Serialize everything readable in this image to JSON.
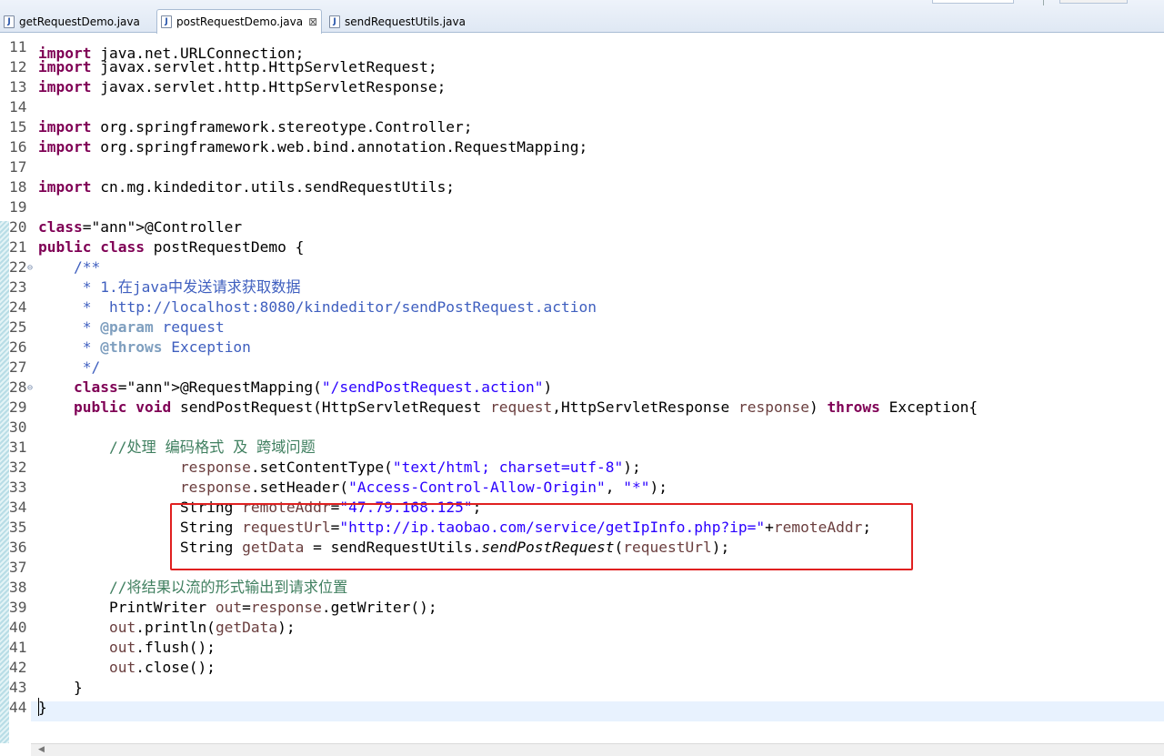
{
  "tabs": [
    {
      "label": "getRequestDemo.java",
      "active": false,
      "icon": "java-file-icon"
    },
    {
      "label": "postRequestDemo.java",
      "active": true,
      "icon": "java-file-icon",
      "close": "⊠"
    },
    {
      "label": "sendRequestUtils.java",
      "active": false,
      "icon": "java-file-icon"
    }
  ],
  "code": {
    "partial_line": "import java.net.URLConnection;",
    "lines": [
      {
        "n": "11",
        "t": ""
      },
      {
        "n": "12",
        "t": "import javax.servlet.http.HttpServletRequest;"
      },
      {
        "n": "13",
        "t": "import javax.servlet.http.HttpServletResponse;"
      },
      {
        "n": "14",
        "t": ""
      },
      {
        "n": "15",
        "t": "import org.springframework.stereotype.Controller;"
      },
      {
        "n": "16",
        "t": "import org.springframework.web.bind.annotation.RequestMapping;"
      },
      {
        "n": "17",
        "t": ""
      },
      {
        "n": "18",
        "t": "import cn.mg.kindeditor.utils.sendRequestUtils;"
      },
      {
        "n": "19",
        "t": ""
      },
      {
        "n": "20",
        "t": "@Controller"
      },
      {
        "n": "21",
        "t": "public class postRequestDemo {"
      },
      {
        "n": "22",
        "t": "    /**"
      },
      {
        "n": "23",
        "t": "     * 1.在java中发送请求获取数据"
      },
      {
        "n": "24",
        "t": "     *  http://localhost:8080/kindeditor/sendPostRequest.action"
      },
      {
        "n": "25",
        "t": "     * @param request"
      },
      {
        "n": "26",
        "t": "     * @throws Exception"
      },
      {
        "n": "27",
        "t": "     */"
      },
      {
        "n": "28",
        "t": "    @RequestMapping(\"/sendPostRequest.action\")"
      },
      {
        "n": "29",
        "t": "    public void sendPostRequest(HttpServletRequest request,HttpServletResponse response) throws Exception{"
      },
      {
        "n": "30",
        "t": ""
      },
      {
        "n": "31",
        "t": "        //处理 编码格式 及 跨域问题"
      },
      {
        "n": "32",
        "t": "                response.setContentType(\"text/html; charset=utf-8\");"
      },
      {
        "n": "33",
        "t": "                response.setHeader(\"Access-Control-Allow-Origin\", \"*\");"
      },
      {
        "n": "34",
        "t": "                String remoteAddr=\"47.79.168.125\";"
      },
      {
        "n": "35",
        "t": "                String requestUrl=\"http://ip.taobao.com/service/getIpInfo.php?ip=\"+remoteAddr;"
      },
      {
        "n": "36",
        "t": "                String getData = sendRequestUtils.sendPostRequest(requestUrl);"
      },
      {
        "n": "37",
        "t": ""
      },
      {
        "n": "38",
        "t": "        //将结果以流的形式输出到请求位置"
      },
      {
        "n": "39",
        "t": "        PrintWriter out=response.getWriter();"
      },
      {
        "n": "40",
        "t": "        out.println(getData);"
      },
      {
        "n": "41",
        "t": "        out.flush();"
      },
      {
        "n": "42",
        "t": "        out.close();"
      },
      {
        "n": "43",
        "t": "    }"
      },
      {
        "n": "44",
        "t": "}"
      }
    ]
  },
  "colors": {
    "keyword": "#7f0055",
    "string": "#2a00ff",
    "annotation": "#646464",
    "javadoc": "#3f5fbf",
    "comment": "#3f7f5f",
    "highlight_box": "#e02020"
  }
}
